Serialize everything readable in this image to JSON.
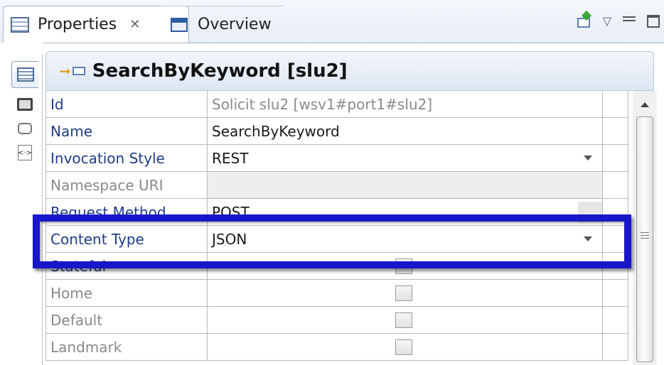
{
  "tabs": {
    "properties_label": "Properties",
    "properties_close": "✕",
    "overview_label": "Overview"
  },
  "view_actions": {
    "menu_glyph": "▽"
  },
  "side_tabs": {
    "code_glyph": "<·>"
  },
  "header": {
    "title": "SearchByKeyword [slu2]"
  },
  "rows": [
    {
      "label": "Id",
      "value": "Solicit slu2  [wsv1#port1#slu2]"
    },
    {
      "label": "Name",
      "value": "SearchByKeyword"
    },
    {
      "label": "Invocation Style",
      "value": "REST"
    },
    {
      "label": "Namespace URI",
      "value": ""
    },
    {
      "label": "Request Method",
      "value": "POST"
    },
    {
      "label": "Content Type",
      "value": "JSON"
    },
    {
      "label": "Stateful",
      "value": ""
    },
    {
      "label": "Home",
      "value": ""
    },
    {
      "label": "Default",
      "value": ""
    },
    {
      "label": "Landmark",
      "value": ""
    }
  ],
  "colors": {
    "highlight": "#1717c9",
    "label_active": "#1f3c88",
    "label_disabled": "#8a8a8a"
  }
}
